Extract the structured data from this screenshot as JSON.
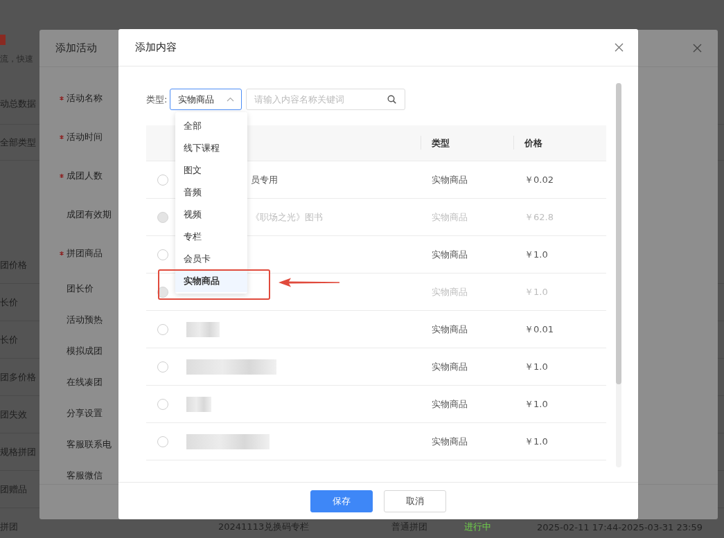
{
  "background": {
    "intro": "流，快速",
    "side_items": [
      "动总数据",
      "全部类型",
      "团价格",
      "长价",
      "长价",
      "团多价格",
      "团失效",
      "规格拼团",
      "团赠品"
    ],
    "last_row": {
      "name": "拼团",
      "title": "20241113兑换码专栏",
      "kind": "普通拼团",
      "status": "进行中",
      "period": "2025-02-11 17:44-2025-03-31 23:59"
    }
  },
  "activity_dialog": {
    "title": "添加活动",
    "fields": [
      {
        "label": "活动名称",
        "required": true
      },
      {
        "label": "活动时间",
        "required": true
      },
      {
        "label": "成团人数",
        "required": true
      },
      {
        "label": "成团有效期",
        "required": false
      },
      {
        "label": "拼团商品",
        "required": true
      },
      {
        "label": "团长价",
        "required": false
      },
      {
        "label": "活动预热",
        "required": false
      },
      {
        "label": "模拟成团",
        "required": false
      },
      {
        "label": "在线凑团",
        "required": false
      },
      {
        "label": "分享设置",
        "required": false
      },
      {
        "label": "客服联系电",
        "required": false
      },
      {
        "label": "客服微信",
        "required": false
      }
    ]
  },
  "content_dialog": {
    "title": "添加内容",
    "filter_label": "类型:",
    "type_select": {
      "value": "实物商品",
      "expanded": true
    },
    "search": {
      "placeholder": "请输入内容名称关键词"
    },
    "dropdown": [
      {
        "label": "全部",
        "selected": false
      },
      {
        "label": "线下课程",
        "selected": false
      },
      {
        "label": "图文",
        "selected": false
      },
      {
        "label": "音频",
        "selected": false
      },
      {
        "label": "视频",
        "selected": false
      },
      {
        "label": "专栏",
        "selected": false
      },
      {
        "label": "会员卡",
        "selected": false
      },
      {
        "label": "实物商品",
        "selected": true
      }
    ],
    "columns": [
      "类型",
      "价格"
    ],
    "rows": [
      {
        "kind": "text",
        "name": "员专用",
        "type": "实物商品",
        "price": "￥0.02",
        "disabled": false
      },
      {
        "kind": "text",
        "name": "《职场之光》图书",
        "type": "实物商品",
        "price": "￥62.8",
        "disabled": true
      },
      {
        "kind": "covered",
        "type": "实物商品",
        "price": "￥1.0",
        "disabled": false
      },
      {
        "kind": "covered",
        "type": "实物商品",
        "price": "￥1.0",
        "disabled": true
      },
      {
        "kind": "blurred",
        "type": "实物商品",
        "price": "￥0.01",
        "disabled": false
      },
      {
        "kind": "blurred",
        "type": "实物商品",
        "price": "￥1.0",
        "disabled": false
      },
      {
        "kind": "blurred",
        "type": "实物商品",
        "price": "￥1.0",
        "disabled": false
      },
      {
        "kind": "blurred",
        "type": "实物商品",
        "price": "￥1.0",
        "disabled": false
      }
    ],
    "buttons": [
      {
        "label": "保存",
        "kind": "primary"
      },
      {
        "label": "取消",
        "kind": "default"
      }
    ]
  }
}
